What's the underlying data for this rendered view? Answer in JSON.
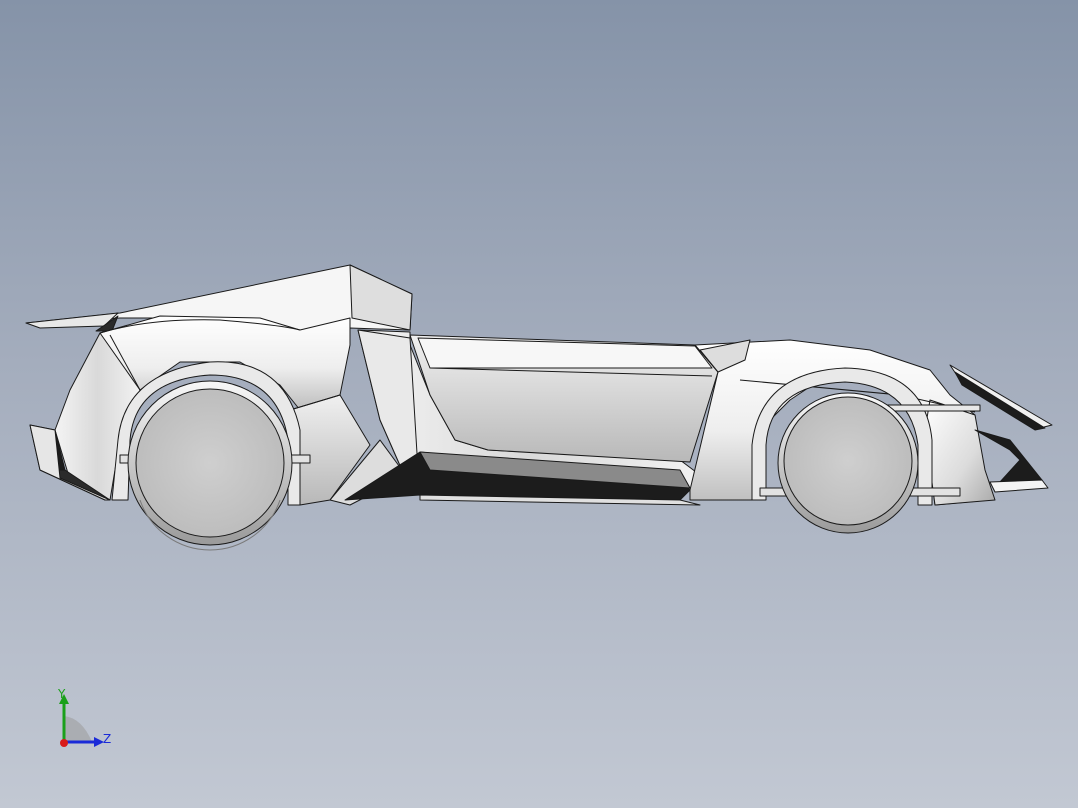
{
  "viewport": {
    "background_top": "#8593a8",
    "background_bottom": "#c2c8d3"
  },
  "model": {
    "shading": "#f2f2f2",
    "edge_color": "#1a1a1a",
    "dark_color": "#1c1c1c"
  },
  "triad": {
    "y_label": "Y",
    "z_label": "Z",
    "y_color": "#1aa01a",
    "z_color": "#1a2ad8",
    "x_color": "#d81a1a"
  }
}
